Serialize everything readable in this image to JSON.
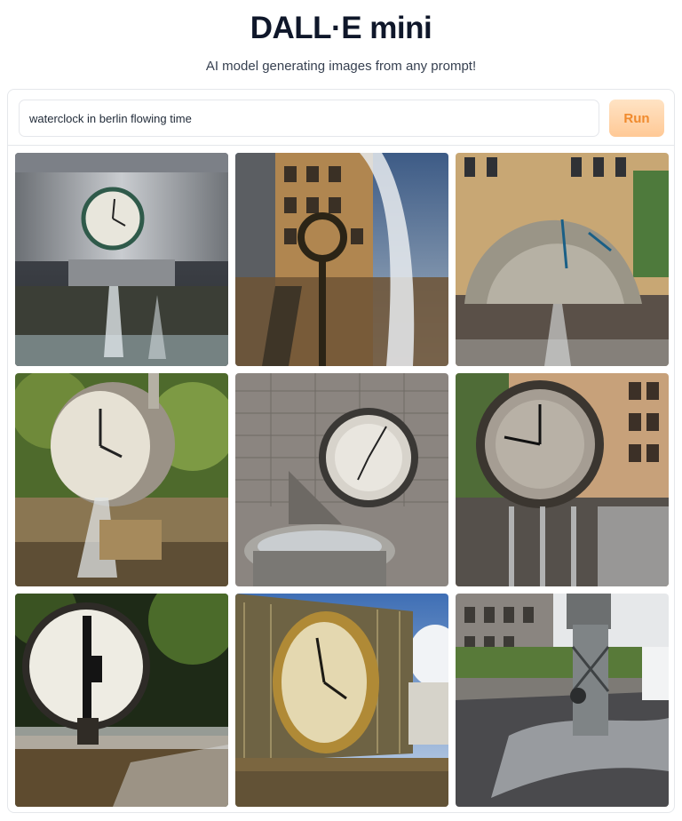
{
  "header": {
    "title": "DALL·E mini",
    "subtitle": "AI model generating images from any prompt!"
  },
  "prompt": {
    "value": "waterclock in berlin flowing time",
    "run_label": "Run"
  },
  "results": {
    "count": 9,
    "images": [
      {
        "name": "generated-image-1",
        "subject": "drum-shaped clock fountain with water spilling"
      },
      {
        "name": "generated-image-2",
        "subject": "clock sculpture between buildings with waterfall"
      },
      {
        "name": "generated-image-3",
        "subject": "arched clock fountain in front of buildings"
      },
      {
        "name": "generated-image-4",
        "subject": "tilted clock with water stream, trees behind"
      },
      {
        "name": "generated-image-5",
        "subject": "clock over basin against brick wall"
      },
      {
        "name": "generated-image-6",
        "subject": "round clock face with dripping water, facade behind"
      },
      {
        "name": "generated-image-7",
        "subject": "white clock face above pool, dark trees"
      },
      {
        "name": "generated-image-8",
        "subject": "golden melting clock in front of glass building"
      },
      {
        "name": "generated-image-9",
        "subject": "metal pillar with water flowing down street"
      }
    ]
  },
  "colors": {
    "accent": "#f08a2d",
    "run_bg_top": "#ffe3c4",
    "run_bg_bottom": "#ffc996",
    "border": "#e5e7eb"
  }
}
